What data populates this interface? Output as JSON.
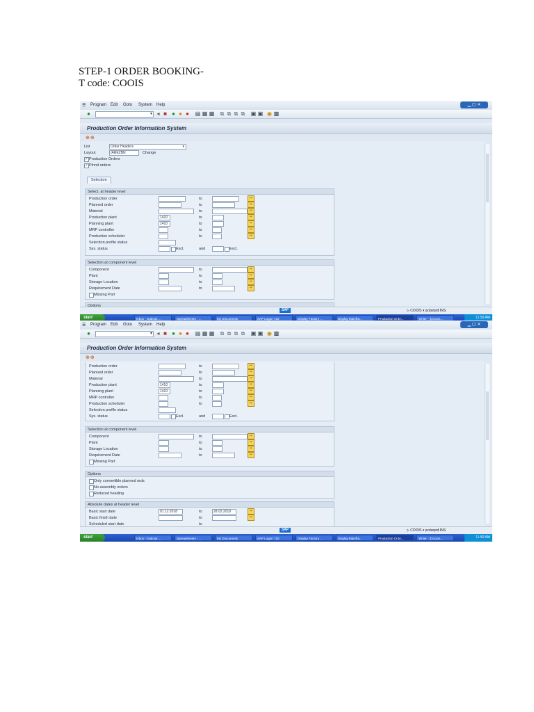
{
  "document": {
    "line1": "STEP-1 ORDER BOOKING-",
    "line2": "T code: COOIS"
  },
  "menu": {
    "items": [
      "Program",
      "Edit",
      "Goto",
      "System",
      "Help"
    ]
  },
  "title": "Production Order Information System",
  "list_label": "List",
  "list_value": "Order Headers",
  "layout_label": "Layout",
  "layout_value": "/AREZBN",
  "layout_change": "Change",
  "checkboxes": {
    "production_orders": "Production Orders",
    "planned_orders": "Plnnd orders"
  },
  "tab_selection": "Selection",
  "header_group": "Select. at header level",
  "component_group": "Selection at component level",
  "options_group": "Options",
  "dates_group": "Absolute dates at header level",
  "to_label": "to",
  "excl_label": "Excl.",
  "and_label": "and",
  "header_fields": [
    {
      "label": "Production order",
      "from": "",
      "to": ""
    },
    {
      "label": "Planned order",
      "from": "",
      "to": ""
    },
    {
      "label": "Material",
      "from": "",
      "to": ""
    },
    {
      "label": "Production plant",
      "from": "1410",
      "to": ""
    },
    {
      "label": "Planning plant",
      "from": "1410",
      "to": ""
    },
    {
      "label": "MRP controller",
      "from": "",
      "to": ""
    },
    {
      "label": "Production scheduler",
      "from": "",
      "to": ""
    },
    {
      "label": "Selection profile status",
      "from": "",
      "to": ""
    },
    {
      "label": "Sys. status",
      "from": "",
      "to": ""
    }
  ],
  "component_fields": [
    {
      "label": "Component"
    },
    {
      "label": "Plant"
    },
    {
      "label": "Storage Location"
    },
    {
      "label": "Requirement Date"
    }
  ],
  "missing_part": "Missing Part",
  "options": [
    "Only convertible planned ords",
    "No assembly orders",
    "Reduced heading"
  ],
  "date_fields": [
    {
      "label": "Basic start date",
      "from": "01.12.2018",
      "to": "28.02.2019"
    },
    {
      "label": "Basic finish date",
      "from": "",
      "to": ""
    },
    {
      "label": "Scheduled start date",
      "from": "",
      "to": ""
    }
  ],
  "status": {
    "sap": "SAP",
    "tcode": "COOIS",
    "server": "pcdarprd",
    "mode": "INS"
  },
  "taskbar": {
    "start": "start",
    "tasks": [
      "Inbox - Outlook ...",
      "Spreadsheets - ...",
      "My Documents",
      "SAP Logon 720",
      "Display Factory ...",
      "Display Mainfra...",
      "Production Orde...",
      "Writer - [Docum..."
    ],
    "clock": "11:50 AM"
  }
}
